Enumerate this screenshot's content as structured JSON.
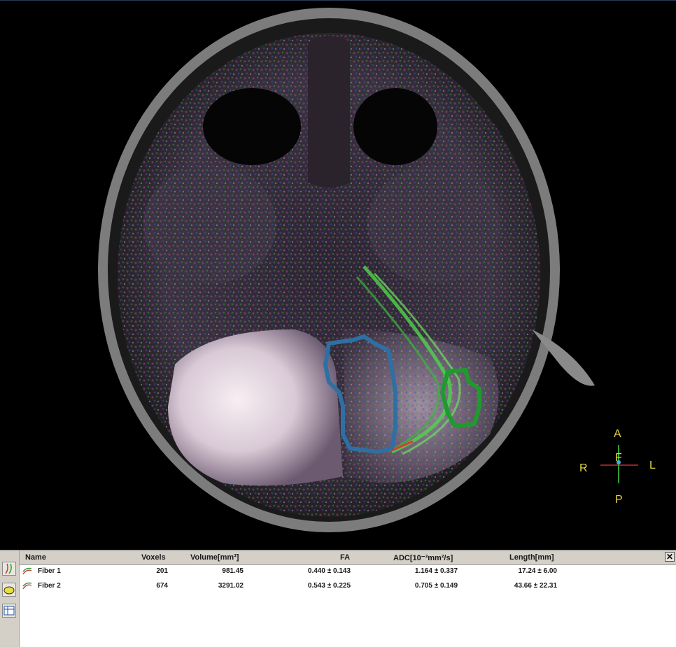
{
  "viewer": {
    "orientation": {
      "anterior": "A",
      "posterior": "P",
      "right": "R",
      "left": "L",
      "foot": "F"
    }
  },
  "roi_colors": {
    "roi_1": "#2f6fa3",
    "roi_2": "#1f9a2e",
    "fibers": "#4fd64a"
  },
  "toolbar": {
    "buttons": [
      {
        "icon": "fiber-tracking-icon"
      },
      {
        "icon": "roi-ellipse-icon"
      },
      {
        "icon": "table-view-icon"
      }
    ]
  },
  "table": {
    "columns": [
      "Name",
      "Voxels",
      "Volume[mm³]",
      "FA",
      "ADC[10⁻³mm²/s]",
      "Length[mm]"
    ],
    "close_label": "✕",
    "rows": [
      {
        "name": "Fiber 1",
        "voxels": "201",
        "volume": "981.45",
        "fa": "0.440 ± 0.143",
        "adc": "1.164 ± 0.337",
        "length": "17.24 ± 6.00"
      },
      {
        "name": "Fiber 2",
        "voxels": "674",
        "volume": "3291.02",
        "fa": "0.543 ± 0.225",
        "adc": "0.705 ± 0.149",
        "length": "43.66 ± 22.31"
      }
    ]
  }
}
